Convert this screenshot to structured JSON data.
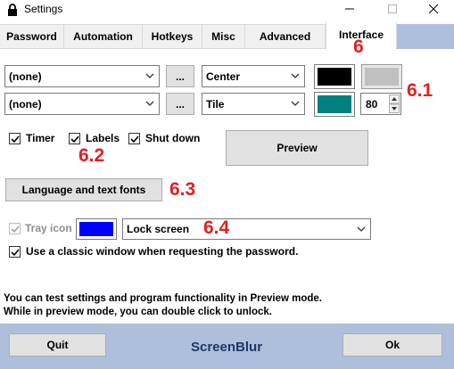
{
  "window": {
    "title": "Settings",
    "controls": {
      "minimize": "minimize-icon",
      "maximize": "maximize-icon",
      "close": "close-icon"
    }
  },
  "tabs": [
    "Password",
    "Automation",
    "Hotkeys",
    "Misc",
    "Advanced",
    "Interface"
  ],
  "active_tab": "Interface",
  "background": {
    "row1": {
      "image_value": "(none)",
      "browse_label": "...",
      "position_value": "Center",
      "color": "#000000",
      "color2": "#c0c0c0"
    },
    "row2": {
      "image_value": "(none)",
      "browse_label": "...",
      "position_value": "Tile",
      "color": "#008080",
      "opacity_value": "80"
    }
  },
  "options": {
    "timer_label": "Timer",
    "timer_checked": true,
    "labels_label": "Labels",
    "labels_checked": true,
    "shutdown_label": "Shut down",
    "shutdown_checked": true,
    "preview_label": "Preview"
  },
  "language_button_label": "Language and text fonts",
  "tray": {
    "label": "Tray icon",
    "checked": true,
    "disabled": true,
    "color": "#0000ff",
    "action_value": "Lock screen"
  },
  "classic_window": {
    "label": "Use a classic window when requesting the password.",
    "checked": true
  },
  "info_lines": [
    "You can test settings and program functionality in Preview mode.",
    "While in preview mode, you can double click to unlock."
  ],
  "footer": {
    "quit_label": "Quit",
    "app_name": "ScreenBlur",
    "ok_label": "Ok"
  },
  "annotations": {
    "tab": "6",
    "colors": "6.1",
    "checkboxes": "6.2",
    "language": "6.3",
    "tray": "6.4"
  },
  "colors": {
    "accent_bar": "#aebfdc",
    "annotation": "#e02020"
  }
}
